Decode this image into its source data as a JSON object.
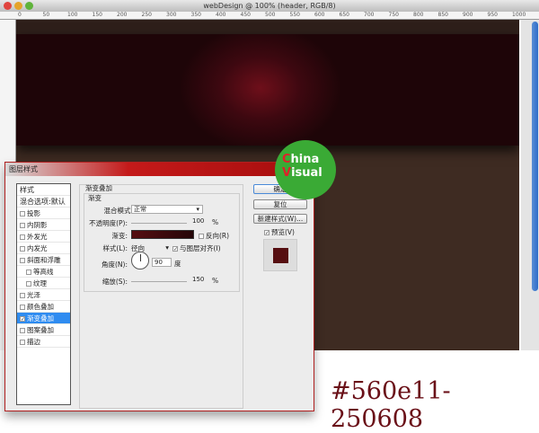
{
  "window": {
    "title": "webDesign @ 100% (header, RGB/8)"
  },
  "ruler": {
    "ticks": [
      "0",
      "50",
      "100",
      "150",
      "200",
      "250",
      "300",
      "350",
      "400",
      "450",
      "500",
      "550",
      "600",
      "650",
      "700",
      "750",
      "800",
      "850",
      "900",
      "950",
      "1000"
    ]
  },
  "dialog": {
    "title": "图层样式",
    "styles": [
      {
        "label": "样式",
        "type": "header"
      },
      {
        "label": "混合选项:默认",
        "type": "header"
      },
      {
        "label": "投影",
        "checked": false
      },
      {
        "label": "内阴影",
        "checked": false
      },
      {
        "label": "外发光",
        "checked": false
      },
      {
        "label": "内发光",
        "checked": false
      },
      {
        "label": "斜面和浮雕",
        "checked": false
      },
      {
        "label": "等高线",
        "checked": false,
        "indent": true
      },
      {
        "label": "纹理",
        "checked": false,
        "indent": true
      },
      {
        "label": "光泽",
        "checked": false
      },
      {
        "label": "颜色叠加",
        "checked": false
      },
      {
        "label": "渐变叠加",
        "checked": true,
        "selected": true
      },
      {
        "label": "图案叠加",
        "checked": false
      },
      {
        "label": "描边",
        "checked": false
      }
    ],
    "panel": {
      "section_title": "渐变叠加",
      "group_title": "渐变",
      "blend_mode_label": "混合模式:",
      "blend_mode": "正常",
      "opacity_label": "不透明度(P):",
      "opacity": "100",
      "opacity_unit": "%",
      "gradient_label": "渐变:",
      "reverse_label": "反向(R)",
      "style_label": "样式(L):",
      "style": "径向",
      "align_label": "与图层对齐(I)",
      "angle_label": "角度(N):",
      "angle": "90",
      "angle_unit": "度",
      "scale_label": "缩放(S):",
      "scale": "150",
      "scale_unit": "%"
    },
    "buttons": {
      "ok": "确定",
      "reset": "复位",
      "new_style": "新建样式(W)...",
      "preview": "预览(V)"
    },
    "colors": {
      "gradient_start": "#560e11",
      "gradient_end": "#250608"
    }
  },
  "logo": {
    "line1": "China",
    "line2": "Visual"
  },
  "caption": "#560e11- 250608"
}
